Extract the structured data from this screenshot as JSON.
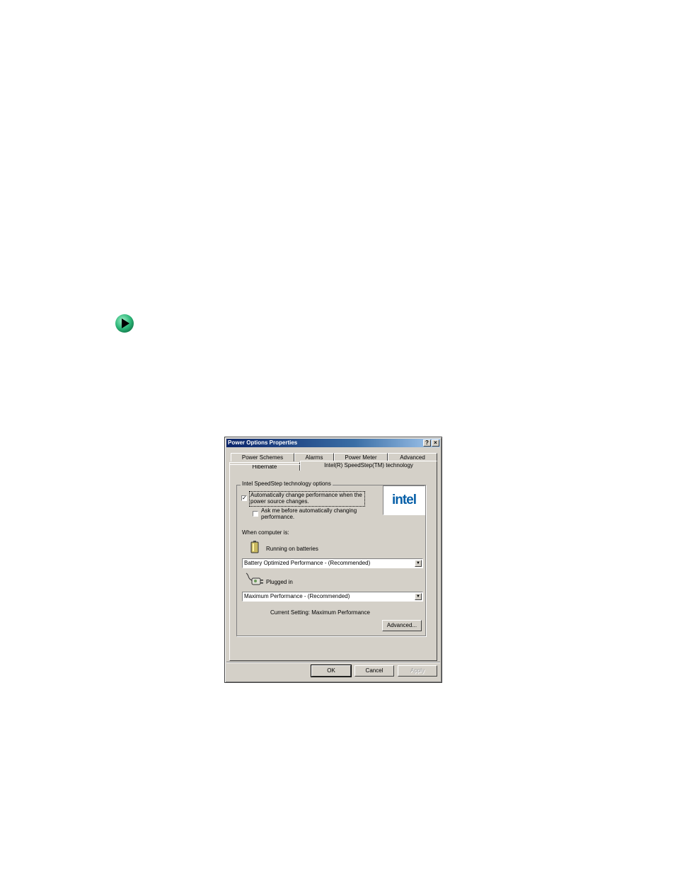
{
  "window": {
    "title": "Power Options Properties",
    "help_glyph": "?",
    "close_glyph": "×"
  },
  "tabs": [
    {
      "label": "Power Schemes"
    },
    {
      "label": "Alarms"
    },
    {
      "label": "Power Meter"
    },
    {
      "label": "Advanced"
    },
    {
      "label": "Hibernate"
    },
    {
      "label": "Intel(R) SpeedStep(TM) technology"
    }
  ],
  "speedstep": {
    "group_label": "Intel SpeedStep technology options",
    "auto_change": {
      "line1": "Automatically change performance when the",
      "line2": "power source changes.",
      "checked": true,
      "mark": "✓"
    },
    "ask_me": {
      "line1": "Ask me before automatically changing",
      "line2": "performance.",
      "checked": false,
      "mark": ""
    },
    "logo_text": "intel",
    "when_label": "When computer is:",
    "batteries_label": "Running on batteries",
    "batteries_value": "Battery Optimized Performance - (Recommended)",
    "plugged_label": "Plugged in",
    "plugged_value": "Maximum Performance - (Recommended)",
    "current_setting": "Current Setting:  Maximum Performance",
    "advanced_button": "Advanced..."
  },
  "buttons": {
    "ok": "OK",
    "cancel": "Cancel",
    "apply": "Apply"
  },
  "colors": {
    "titlebar_start": "#0a246a",
    "dialog_face": "#d4d0c8",
    "bullet_green": "#2eb87a",
    "intel_blue": "#0860a8"
  }
}
